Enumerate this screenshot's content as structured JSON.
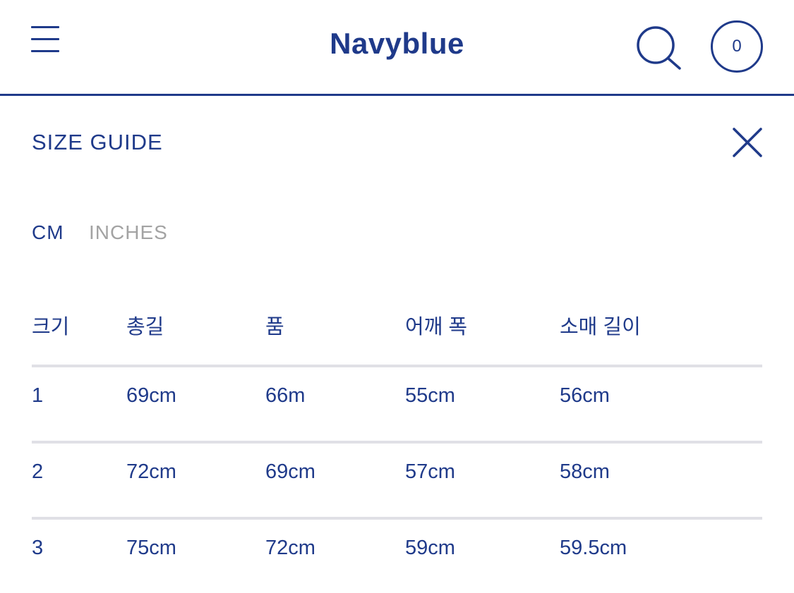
{
  "header": {
    "brand": "Navyblue",
    "cart_count": "0"
  },
  "panel": {
    "title": "SIZE GUIDE"
  },
  "units": {
    "cm": "CM",
    "inches": "INCHES",
    "selected": "CM"
  },
  "table": {
    "columns": [
      "크기",
      "총길",
      "품",
      "어깨 폭",
      "소매 길이"
    ],
    "rows": [
      [
        "1",
        "69cm",
        "66m",
        "55cm",
        "56cm"
      ],
      [
        "2",
        "72cm",
        "69cm",
        "57cm",
        "58cm"
      ],
      [
        "3",
        "75cm",
        "72cm",
        "59cm",
        "59.5cm"
      ]
    ]
  },
  "colors": {
    "accent": "#1f3a8a",
    "inactive": "#a3a3a3",
    "divider": "#e0e0e6"
  }
}
